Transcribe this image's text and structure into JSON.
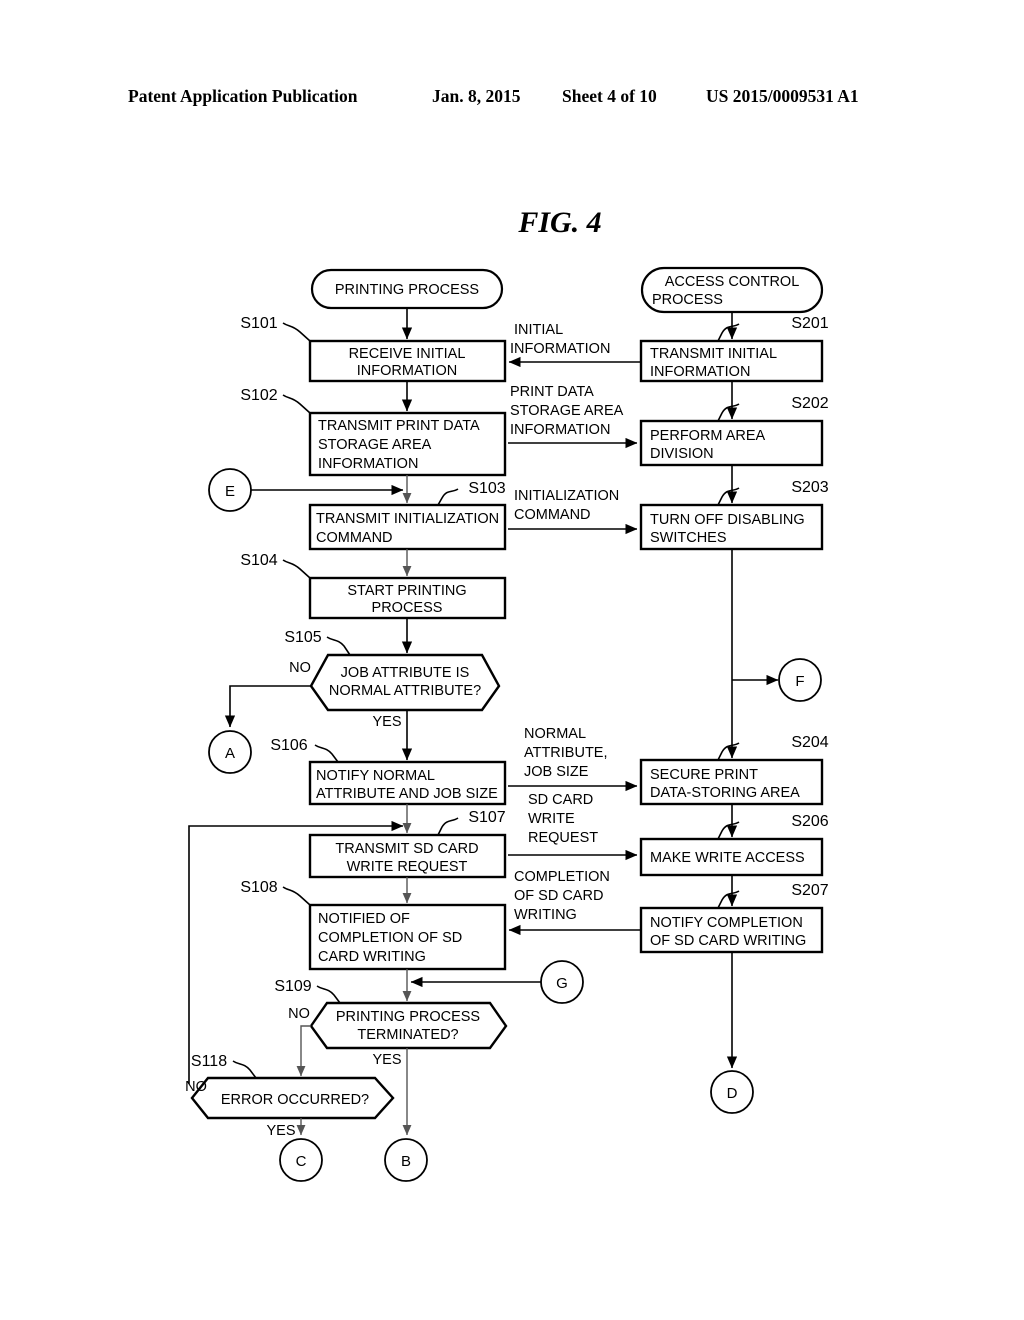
{
  "header": {
    "publication": "Patent Application Publication",
    "date": "Jan. 8, 2015",
    "sheet": "Sheet 4 of 10",
    "number": "US 2015/0009531 A1"
  },
  "figure": {
    "title": "FIG. 4"
  },
  "terminals": [
    {
      "id": "printing-process",
      "label": "PRINTING PROCESS"
    },
    {
      "id": "access-control-process",
      "label": "ACCESS CONTROL PROCESS",
      "line1": "ACCESS CONTROL",
      "line2": "PROCESS"
    }
  ],
  "left_column": {
    "title": "PRINTING PROCESS",
    "steps": [
      {
        "ref": "S101",
        "line1": "RECEIVE INITIAL",
        "line2": "INFORMATION",
        "line3": "",
        "shape": "process",
        "align": "center"
      },
      {
        "ref": "S102",
        "line1": "TRANSMIT PRINT DATA",
        "line2": "STORAGE AREA",
        "line3": "INFORMATION",
        "shape": "process",
        "align": "left"
      },
      {
        "ref": "S103",
        "line1": "TRANSMIT INITIALIZATION",
        "line2": "COMMAND",
        "line3": "",
        "shape": "process",
        "align": "left"
      },
      {
        "ref": "S104",
        "line1": "START PRINTING",
        "line2": "PROCESS",
        "line3": "",
        "shape": "process",
        "align": "center"
      },
      {
        "ref": "S105",
        "line1": "JOB ATTRIBUTE IS",
        "line2": "NORMAL ATTRIBUTE?",
        "line3": "",
        "shape": "decision",
        "align": "center"
      },
      {
        "ref": "S106",
        "line1": "NOTIFY NORMAL",
        "line2": "ATTRIBUTE AND JOB SIZE",
        "line3": "",
        "shape": "process",
        "align": "left"
      },
      {
        "ref": "S107",
        "line1": "TRANSMIT SD CARD",
        "line2": "WRITE REQUEST",
        "line3": "",
        "shape": "process",
        "align": "center"
      },
      {
        "ref": "S108",
        "line1": "NOTIFIED OF",
        "line2": "COMPLETION OF SD",
        "line3": "CARD WRITING",
        "shape": "process",
        "align": "left"
      },
      {
        "ref": "S109",
        "line1": "PRINTING PROCESS",
        "line2": "TERMINATED?",
        "line3": "",
        "shape": "decision",
        "align": "center"
      },
      {
        "ref": "S118",
        "line1": "ERROR OCCURRED?",
        "line2": "",
        "line3": "",
        "shape": "decision",
        "align": "center"
      }
    ]
  },
  "right_column": {
    "title": "ACCESS CONTROL PROCESS",
    "steps": [
      {
        "ref": "S201",
        "line1": "TRANSMIT INITIAL",
        "line2": "INFORMATION",
        "shape": "process",
        "align": "left"
      },
      {
        "ref": "S202",
        "line1": "PERFORM AREA",
        "line2": "DIVISION",
        "shape": "process",
        "align": "left"
      },
      {
        "ref": "S203",
        "line1": "TURN OFF DISABLING",
        "line2": "SWITCHES",
        "shape": "process",
        "align": "left"
      },
      {
        "ref": "S204",
        "line1": "SECURE PRINT",
        "line2": "DATA-STORING AREA",
        "shape": "process",
        "align": "left"
      },
      {
        "ref": "S206",
        "line1": "MAKE WRITE ACCESS",
        "line2": "",
        "shape": "process",
        "align": "left"
      },
      {
        "ref": "S207",
        "line1": "NOTIFY COMPLETION",
        "line2": "OF SD CARD WRITING",
        "shape": "process",
        "align": "left"
      }
    ]
  },
  "messages": [
    {
      "id": "initial-information",
      "line1": "INITIAL",
      "line2": "INFORMATION",
      "line3": "",
      "direction": "right-to-left"
    },
    {
      "id": "print-data-storage-area-information",
      "line1": "PRINT DATA",
      "line2": "STORAGE AREA",
      "line3": "INFORMATION",
      "direction": "left-to-right"
    },
    {
      "id": "initialization-command",
      "line1": "INITIALIZATION",
      "line2": "COMMAND",
      "line3": "",
      "direction": "left-to-right"
    },
    {
      "id": "normal-attribute-job-size",
      "line1": "NORMAL",
      "line2": "ATTRIBUTE,",
      "line3": "JOB SIZE",
      "direction": "left-to-right"
    },
    {
      "id": "sd-card-write-request",
      "line1": "SD CARD",
      "line2": "WRITE",
      "line3": "REQUEST",
      "direction": "left-to-right"
    },
    {
      "id": "completion-of-sd-card-writing",
      "line1": "COMPLETION",
      "line2": "OF SD CARD",
      "line3": "WRITING",
      "direction": "right-to-left"
    }
  ],
  "connectors": [
    {
      "id": "connector-e",
      "label": "E",
      "role": "entry"
    },
    {
      "id": "connector-a",
      "label": "A",
      "role": "exit"
    },
    {
      "id": "connector-f",
      "label": "F",
      "role": "exit"
    },
    {
      "id": "connector-g",
      "label": "G",
      "role": "entry"
    },
    {
      "id": "connector-c",
      "label": "C",
      "role": "exit"
    },
    {
      "id": "connector-b",
      "label": "B",
      "role": "exit"
    },
    {
      "id": "connector-d",
      "label": "D",
      "role": "exit"
    }
  ],
  "branch_labels": {
    "s105_no": "NO",
    "s105_yes": "YES",
    "s109_no": "NO",
    "s109_yes": "YES",
    "s118_no": "NO",
    "s118_yes": "YES"
  },
  "colors": {
    "ink": "#000000",
    "paper": "#ffffff"
  }
}
